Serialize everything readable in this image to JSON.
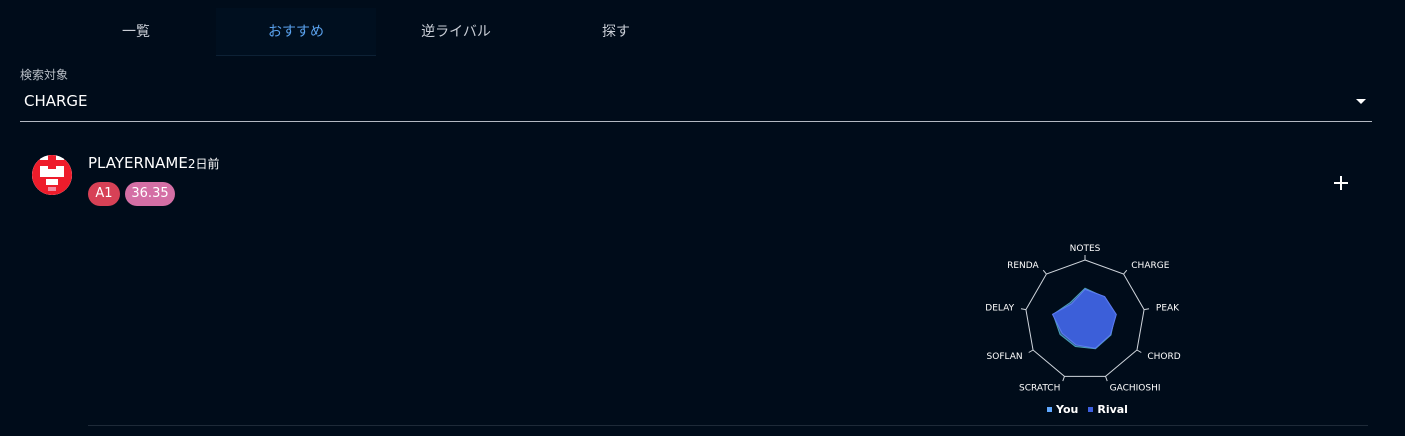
{
  "tabs": [
    {
      "label": "一覧",
      "active": false
    },
    {
      "label": "おすすめ",
      "active": true
    },
    {
      "label": "逆ライバル",
      "active": false
    },
    {
      "label": "探す",
      "active": false
    }
  ],
  "search": {
    "label": "検索対象",
    "value": "CHARGE"
  },
  "player": {
    "name": "PLAYERNAME",
    "time_ago": "2日前",
    "rank": "A1",
    "score": "36.35",
    "add_icon": "plus-icon"
  },
  "colors": {
    "accent": "#5aa2ee",
    "rank_badge": "#d74156",
    "score_badge": "#d46fa5",
    "you": "#5fa8ff",
    "rival": "#3d5fe0"
  },
  "chart_data": {
    "type": "radar",
    "axes": [
      "NOTES",
      "CHARGE",
      "PEAK",
      "CHORD",
      "GACHIOSHI",
      "SCRATCH",
      "SOFLAN",
      "DELAY",
      "RENDA"
    ],
    "series": [
      {
        "name": "You",
        "values": [
          0.53,
          0.5,
          0.51,
          0.5,
          0.51,
          0.47,
          0.48,
          0.54,
          0.38
        ]
      },
      {
        "name": "Rival",
        "values": [
          0.51,
          0.51,
          0.53,
          0.49,
          0.5,
          0.44,
          0.44,
          0.55,
          0.35
        ]
      }
    ],
    "legend": [
      "You",
      "Rival"
    ]
  }
}
